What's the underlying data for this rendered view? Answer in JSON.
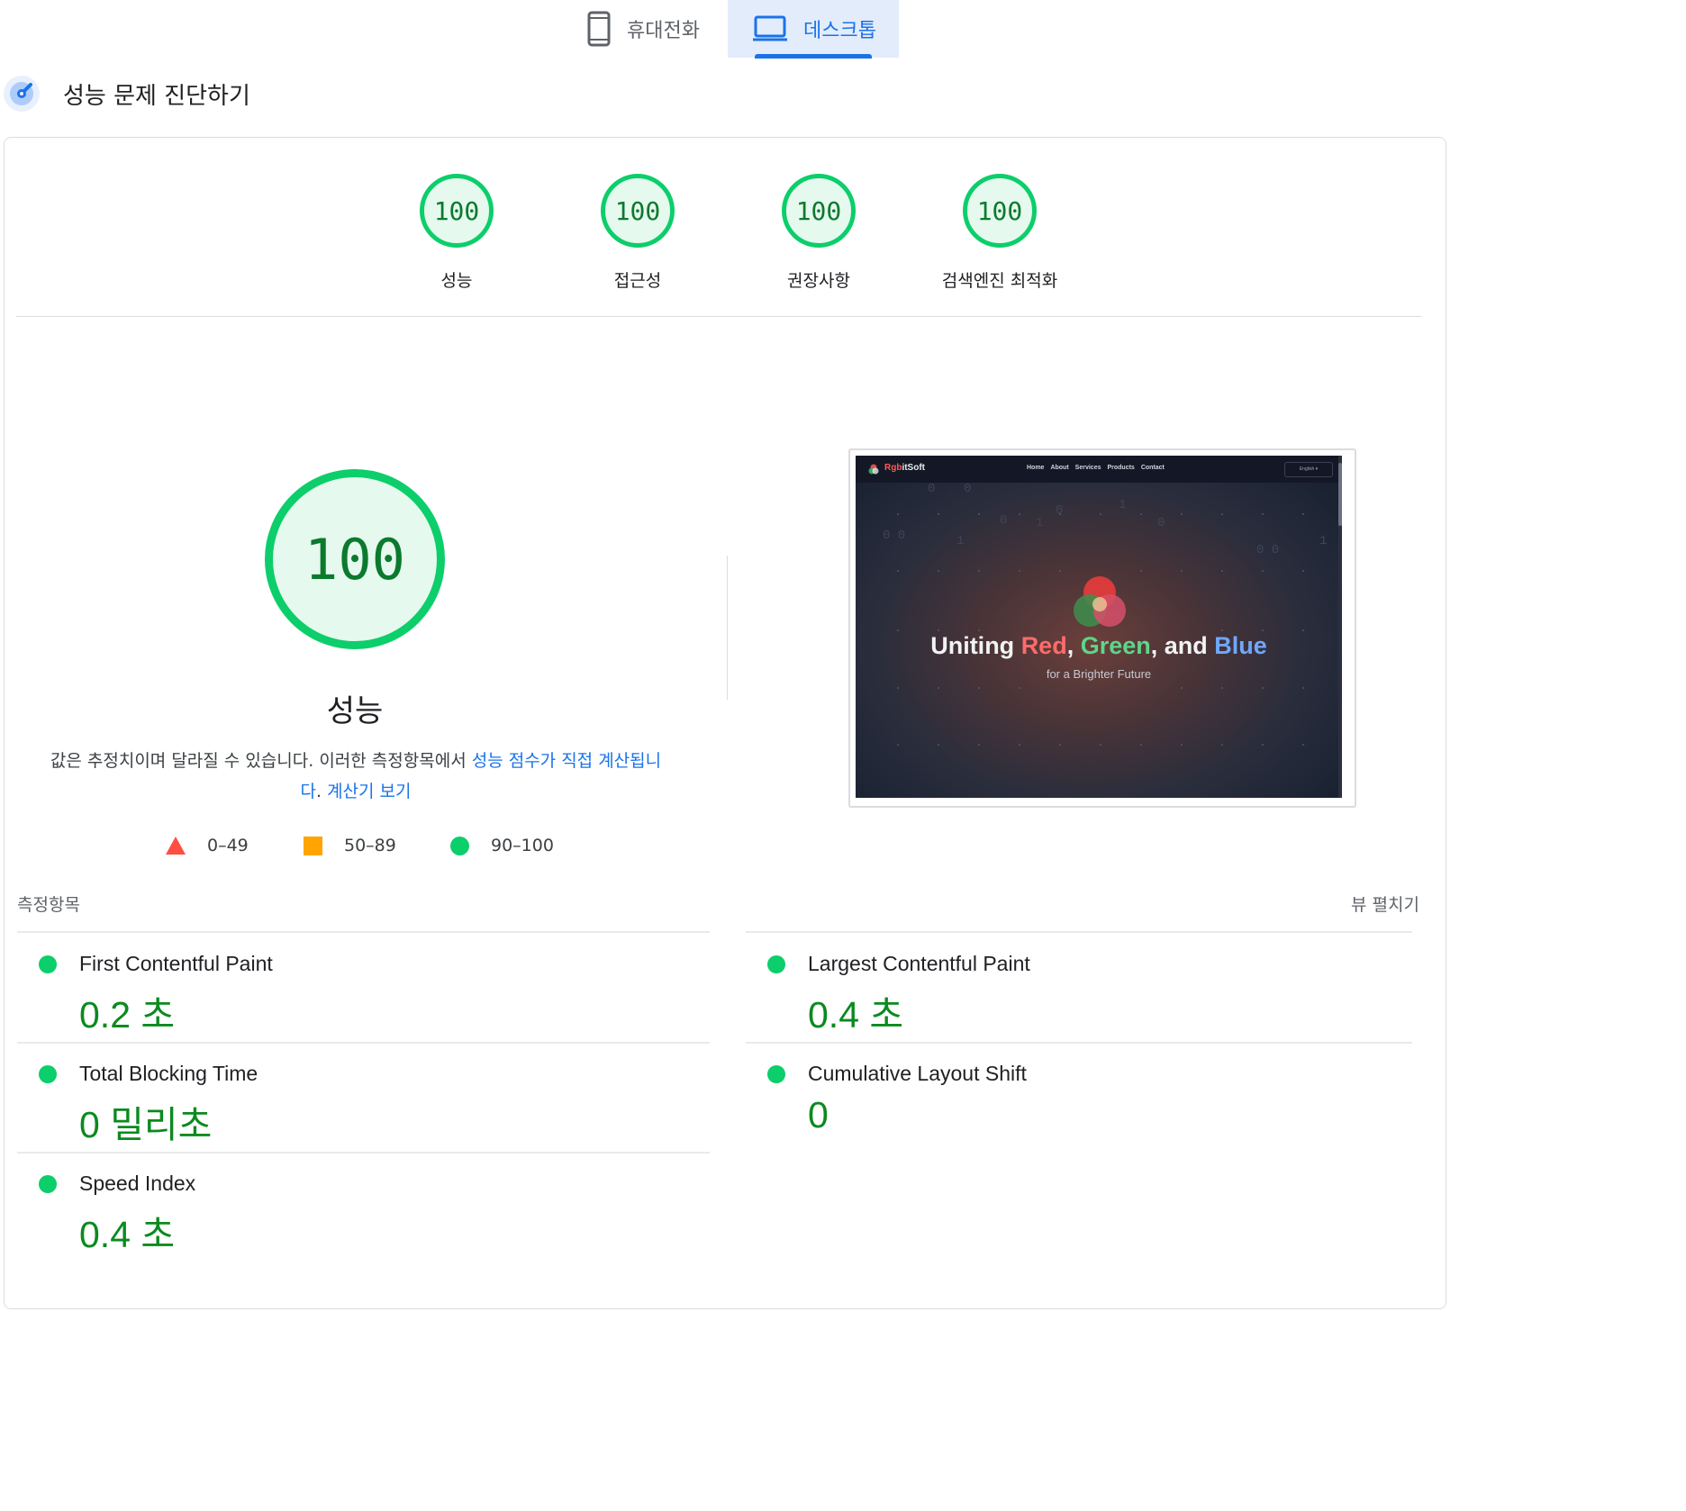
{
  "tabs": {
    "mobile_label": "휴대전화",
    "desktop_label": "데스크톱",
    "selected": "desktop"
  },
  "header": {
    "title": "성능 문제 진단하기"
  },
  "categories": [
    {
      "score": "100",
      "label": "성능"
    },
    {
      "score": "100",
      "label": "접근성"
    },
    {
      "score": "100",
      "label": "권장사항"
    },
    {
      "score": "100",
      "label": "검색엔진 최적화"
    }
  ],
  "performance": {
    "score": "100",
    "label": "성능",
    "desc_text": "값은 추정치이며 달라질 수 있습니다. 이러한 측정항목에서 ",
    "desc_link1": "성능 점수가 직접 계산됩니다",
    "desc_sep": ". ",
    "desc_link2": "계산기 보기"
  },
  "legend": {
    "fail": "0–49",
    "average": "50–89",
    "pass": "90–100"
  },
  "screenshot": {
    "brand_prefix": "Rgb",
    "brand_suffix": "itSoft",
    "nav": [
      "Home",
      "About",
      "Services",
      "Products",
      "Contact"
    ],
    "lang": "English ▾",
    "title_parts": [
      "Uniting ",
      "Red",
      ", ",
      "Green",
      ", and ",
      "Blue"
    ],
    "subtitle": "for a Brighter Future"
  },
  "metrics": {
    "title": "측정항목",
    "view_toggle": "뷰 펼치기",
    "items": [
      {
        "name": "First Contentful Paint",
        "value": "0.2 초"
      },
      {
        "name": "Largest Contentful Paint",
        "value": "0.4 초"
      },
      {
        "name": "Total Blocking Time",
        "value": "0 밀리초"
      },
      {
        "name": "Cumulative Layout Shift",
        "value": "0"
      },
      {
        "name": "Speed Index",
        "value": "0.4 초"
      }
    ]
  },
  "colors": {
    "pass": "#0cce6b",
    "average": "#ffa400",
    "fail": "#ff4e42",
    "accent": "#1a73e8",
    "metric_value": "#0b8a1f"
  },
  "icons": {
    "mobile": "smartphone-icon",
    "desktop": "laptop-icon",
    "diagnose": "gauge-icon"
  }
}
